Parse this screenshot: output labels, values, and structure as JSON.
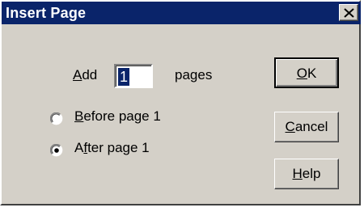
{
  "window": {
    "title": "Insert Page"
  },
  "add_row": {
    "add_prefix": "A",
    "add_rest": "dd",
    "input_value": "1",
    "suffix": "pages"
  },
  "options": {
    "before": {
      "mnemonic": "B",
      "rest": "efore page 1",
      "selected": false
    },
    "after": {
      "pre": "A",
      "mnemonic": "f",
      "rest": "ter page 1",
      "selected": true
    }
  },
  "buttons": {
    "ok": {
      "mnemonic": "O",
      "rest": "K"
    },
    "cancel": {
      "mnemonic": "C",
      "rest": "ancel"
    },
    "help": {
      "mnemonic": "H",
      "rest": "elp"
    }
  },
  "colors": {
    "titlebar": "#0a246a",
    "dialog_face": "#d4d0c8"
  },
  "icons": {
    "close": "close-icon",
    "radio_on": "radio-selected-icon",
    "radio_off": "radio-unselected-icon"
  }
}
